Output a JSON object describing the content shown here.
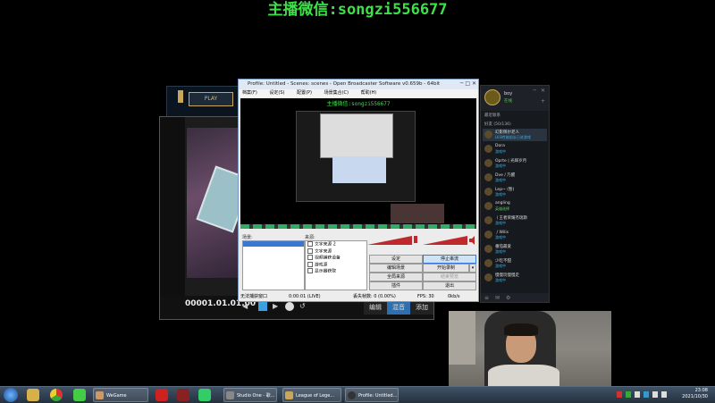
{
  "stream_overlay": {
    "title": "主播微信:songzi556677"
  },
  "lol_client": {
    "play_label": "PLAY"
  },
  "player": {
    "timecode": "00001.01.01.00",
    "tabs": [
      "编辑",
      "混音",
      "添加"
    ]
  },
  "obs": {
    "title": "Profile: Untitled - Scenes: scenes - Open Broadcaster Software v0.659b - 64bit",
    "menu": [
      "档案(F)",
      "设定(S)",
      "配置(P)",
      "场景集合(C)",
      "帮助(H)"
    ],
    "preview_title": "主播微信:songzi556677",
    "scenes_label": "场景:",
    "sources_label": "来源:",
    "sources": [
      "文字来源 2",
      "文字来源",
      "视频捕获设备",
      "游戏源",
      "显示器获取"
    ],
    "buttons": {
      "settings": "设定",
      "stop_stream": "停止串流",
      "edit_scene": "编辑场景",
      "start_recording": "开始录制",
      "global_sources": "全局来源",
      "stop_preview": "结束预览",
      "plugins": "插件",
      "exit": "退出"
    },
    "status": {
      "left": "无法捕获窗口",
      "time": "0:00:01 (LIVE)",
      "dropped": "丢失帧数: 0 (0.00%)",
      "fps": "FPS: 30",
      "rate": "0kb/s"
    }
  },
  "chat": {
    "username": "boy",
    "status": "在线",
    "section": "最近联系",
    "group": "好友 (50/136)",
    "friends": [
      {
        "name": "幻影佩尔老人",
        "status": "LV.8性能组长已进游戏"
      },
      {
        "name": "Dora",
        "status": "游戏中"
      },
      {
        "name": "Oprte | 光辉岁月",
        "status": "游戏中"
      },
      {
        "name": "Dve / 乃醒",
        "status": "游戏中"
      },
      {
        "name": "Lep~ (暂)",
        "status": "游戏中"
      },
      {
        "name": "angling",
        "status": "英雄选择"
      },
      {
        "name": "丨王者荣耀杰瑞斯",
        "status": "游戏中"
      },
      {
        "name": "丿Wilis",
        "status": "游戏中"
      },
      {
        "name": "番茄最爱",
        "status": "游戏中"
      },
      {
        "name": "少吃不甜",
        "status": "游戏中"
      },
      {
        "name": "慢慢玩慢慢走",
        "status": "游戏中"
      }
    ]
  },
  "taskbar": {
    "tasks": [
      "WeGame",
      "Studio One - 歌...",
      "League of Lege...",
      "Profile: Untitled..."
    ],
    "clock_time": "23:08",
    "clock_date": "2021/10/30"
  },
  "colors": {
    "overlay_green": "#3ee04a",
    "obs_accent": "#3b76d0",
    "chat_status_blue": "#48b0e0"
  }
}
